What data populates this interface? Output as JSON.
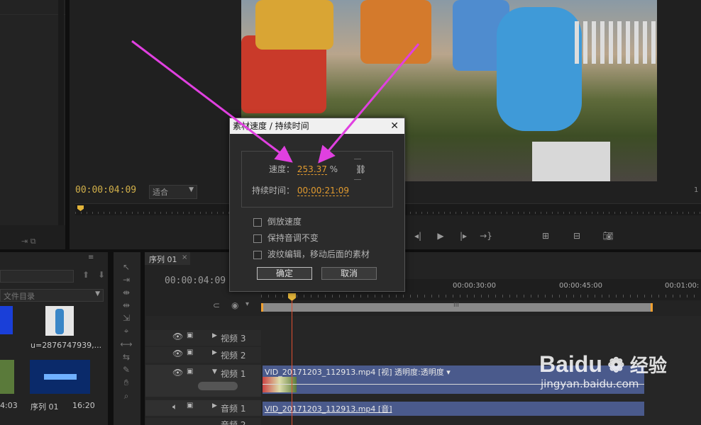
{
  "program_monitor": {
    "timecode": "00:00:04:09",
    "fit_select": "适合",
    "page_indicator": "1"
  },
  "dialog": {
    "title": "素材速度 / 持续时间",
    "speed_label": "速度：",
    "speed_value": "253.37",
    "speed_unit": "%",
    "duration_label": "持续时间：",
    "duration_value": "00:00:21:09",
    "reverse_label": "倒放速度",
    "pitch_label": "保持音调不变",
    "ripple_label": "波纹编辑，移动后面的素材",
    "ok": "确定",
    "cancel": "取消"
  },
  "project_panel": {
    "search_placeholder": "文件目录",
    "items": [
      {
        "label": "u=2876747939,...",
        "type": "image"
      },
      {
        "label": "序列 01",
        "duration": "16:20",
        "type": "sequence"
      },
      {
        "duration": "4:03"
      }
    ]
  },
  "timeline": {
    "tab": "序列 01",
    "timecode": "00:00:04:09",
    "ruler": [
      "00:00:30:00",
      "00:00:45:00",
      "00:01:00:"
    ],
    "tracks": [
      {
        "name": "视频 3"
      },
      {
        "name": "视频 2"
      },
      {
        "name": "视频 1",
        "clip": "VID_20171203_112913.mp4  [视] 透明度:透明度 ▾"
      },
      {
        "name": "音频 1",
        "clip": "VID_20171203_112913.mp4  [音]"
      },
      {
        "name": "音频 2"
      }
    ]
  },
  "watermark": {
    "brand": "Baidu",
    "brand_cn": "经验",
    "url": "jingyan.baidu.com"
  },
  "colors": {
    "annotation_arrow": "#e040e0",
    "timecode": "#d2b04a",
    "accent_orange": "#e29b2f",
    "playhead": "#e05030",
    "clip_blue": "#4a5a8c"
  }
}
